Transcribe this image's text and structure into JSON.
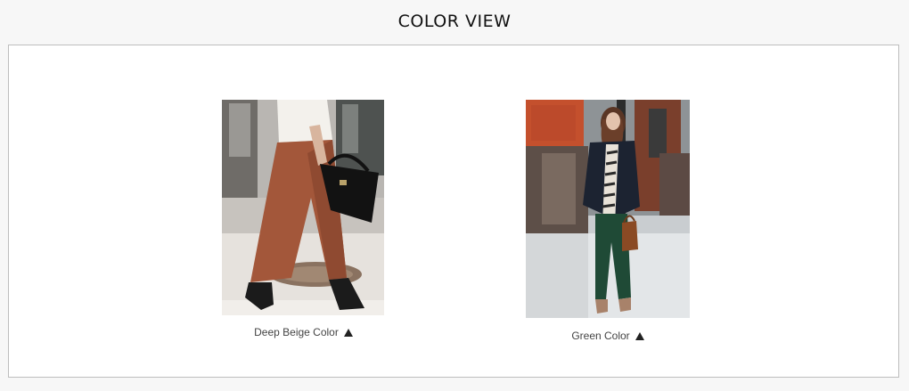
{
  "section": {
    "title": "COLOR VIEW"
  },
  "items": [
    {
      "caption": "Deep Beige Color",
      "photo_desc": "woman in brown wide pants with black handbag",
      "icon": "triangle-up-icon"
    },
    {
      "caption": "Green Color",
      "photo_desc": "woman in dark green pants with navy jacket and brown bag",
      "icon": "triangle-up-icon"
    }
  ],
  "colors": {
    "background": "#f7f7f7",
    "panel": "#ffffff",
    "border": "#bdbdbd",
    "text": "#444444"
  }
}
